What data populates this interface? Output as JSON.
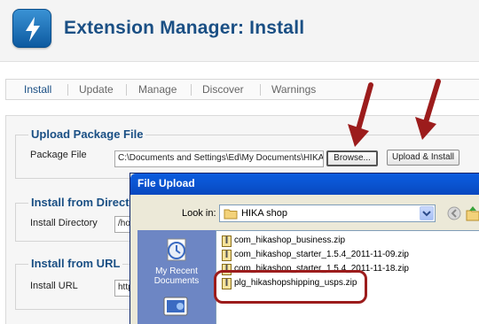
{
  "header": {
    "title": "Extension Manager: Install",
    "logo_icon": "joomla-lightning-icon"
  },
  "tabs": [
    {
      "label": "Install",
      "active": true
    },
    {
      "label": "Update",
      "active": false
    },
    {
      "label": "Manage",
      "active": false
    },
    {
      "label": "Discover",
      "active": false
    },
    {
      "label": "Warnings",
      "active": false
    }
  ],
  "upload": {
    "legend": "Upload Package File",
    "package_label": "Package File",
    "package_value": "C:\\Documents and Settings\\Ed\\My Documents\\HIKA",
    "browse_label": "Browse...",
    "install_label": "Upload & Install"
  },
  "install_dir": {
    "legend": "Install from Directo",
    "label": "Install Directory",
    "value": "/ho"
  },
  "install_url": {
    "legend": "Install from URL",
    "label": "Install URL",
    "value": "http"
  },
  "dialog": {
    "title": "File Upload",
    "lookin_label": "Look in:",
    "lookin_value": "HIKA shop",
    "places": [
      {
        "label": "My Recent Documents",
        "icon": "recent-documents-icon"
      },
      {
        "label": "",
        "icon": "desktop-icon"
      }
    ],
    "files": [
      "com_hikashop_business.zip",
      "com_hikashop_starter_1.5.4_2011-11-09.zip",
      "com_hikashop_starter_1.5.4_2011-11-18.zip",
      "plg_hikashopshipping_usps.zip"
    ],
    "highlighted_file": "plg_hikashopshipping_usps.zip"
  },
  "colors": {
    "accent": "#1a4f84",
    "arrow": "#9c1c1c",
    "dialog_title": "#0a56d4"
  }
}
